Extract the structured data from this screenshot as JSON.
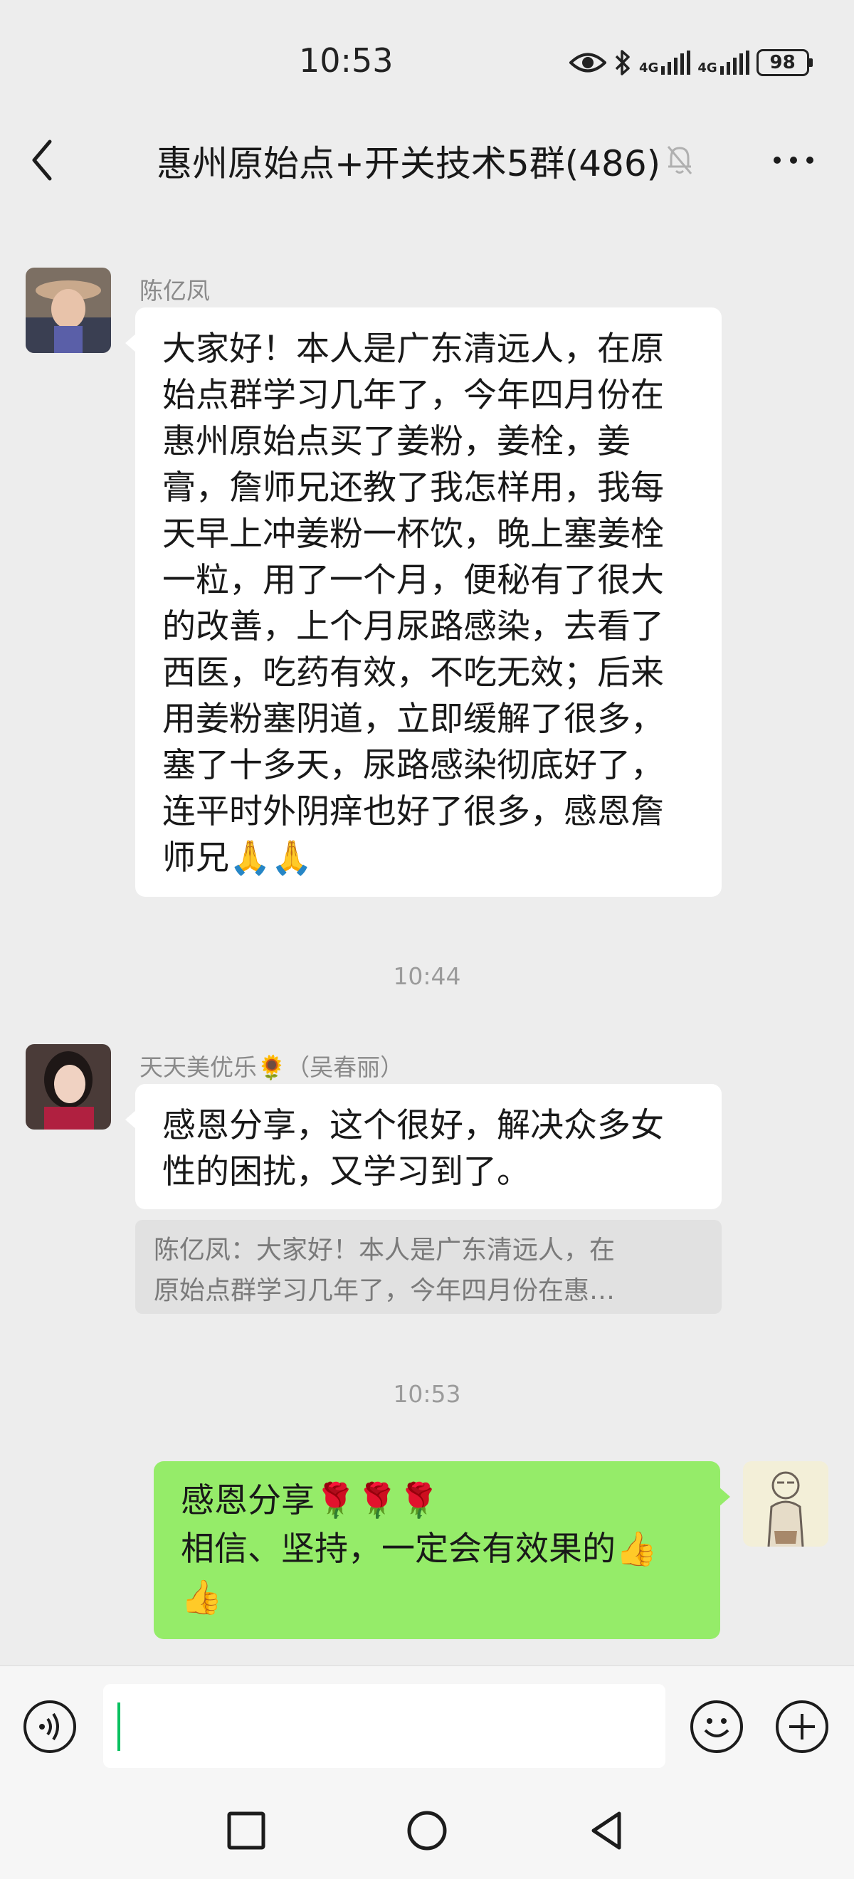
{
  "status_bar": {
    "time": "10:53",
    "network_1": "4G",
    "network_2": "4G",
    "battery": "98"
  },
  "header": {
    "title": "惠州原始点+开关技术5群(486)",
    "back_icon": "chevron-left-icon",
    "mute_icon": "bell-off-icon",
    "more_icon": "more-dots-icon"
  },
  "messages": [
    {
      "sender": "陈亿凤",
      "lines": [
        "大家好！本人是广东清远人，在原",
        "始点群学习几年了，今年四月份在",
        "惠州原始点买了姜粉，姜栓，姜",
        "膏，詹师兄还教了我怎样用，我每",
        "天早上冲姜粉一杯饮，晚上塞姜栓",
        "一粒，用了一个月，便秘有了很大",
        "的改善，上个月尿路感染，去看了",
        "西医，吃药有效，不吃无效；后来",
        "用姜粉塞阴道，立即缓解了很多，",
        "塞了十多天，尿路感染彻底好了，",
        "连平时外阴痒也好了很多，感恩詹",
        "师兄🙏🙏"
      ]
    },
    {
      "timestamp": "10:44",
      "sender": "天天美优乐🌻（吴春丽）",
      "lines": [
        "感恩分享，这个很好，解决众多女",
        "性的困扰，又学习到了。"
      ],
      "quote_lines": [
        "陈亿凤：大家好！本人是广东清远人，在",
        "原始点群学习几年了，今年四月份在惠…"
      ]
    },
    {
      "timestamp": "10:53",
      "lines": [
        "感恩分享🌹🌹🌹",
        "相信、坚持，一定会有效果的👍",
        "👍"
      ]
    }
  ],
  "input_bar": {
    "voice_icon": "voice-icon",
    "emoji_icon": "emoji-icon",
    "plus_icon": "plus-icon"
  },
  "nav_bar": {
    "recents_icon": "square-icon",
    "home_icon": "circle-icon",
    "back_icon": "triangle-back-icon"
  },
  "colors": {
    "background": "#ededed",
    "my_bubble": "#95ec69",
    "other_bubble": "#ffffff",
    "caret": "#07c160"
  }
}
